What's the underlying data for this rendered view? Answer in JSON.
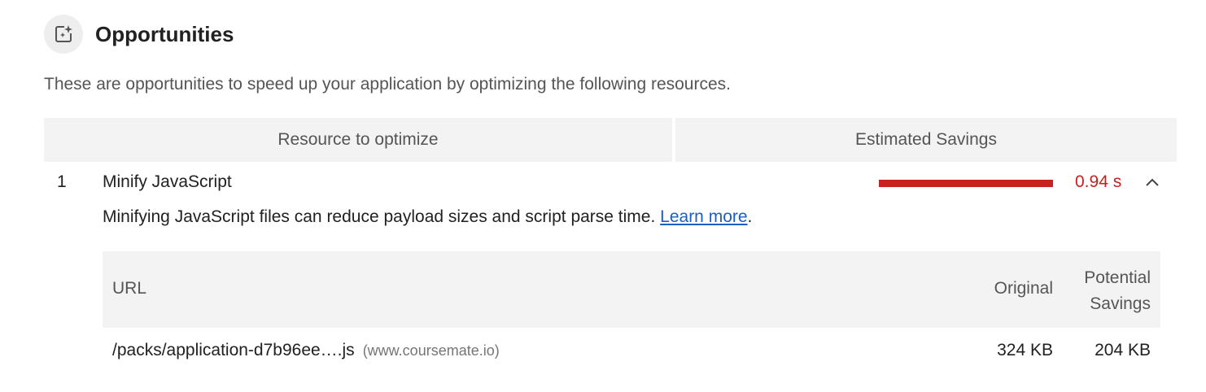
{
  "section": {
    "title": "Opportunities",
    "icon": "opportunities-icon",
    "description": "These are opportunities to speed up your application by optimizing the following resources."
  },
  "table": {
    "columns": [
      "Resource to optimize",
      "Estimated Savings"
    ]
  },
  "audit": {
    "index": "1",
    "title": "Minify JavaScript",
    "savings": "0.94 s",
    "savings_color": "#c7221f",
    "savings_fraction": 1.0,
    "description": "Minifying JavaScript files can reduce payload sizes and script parse time.",
    "learn_more": "Learn more",
    "description_end": ".",
    "expanded": true
  },
  "details": {
    "headers": {
      "url": "URL",
      "original": "Original",
      "potential_line1": "Potential",
      "potential_line2": "Savings"
    },
    "rows": [
      {
        "url": "/packs/application-d7b96ee….js",
        "host": "(www.coursemate.io)",
        "original": "324 KB",
        "savings": "204 KB"
      }
    ]
  },
  "colors": {
    "link": "#1a5fc7",
    "header_bg": "#f3f3f3",
    "fail": "#c7221f"
  }
}
